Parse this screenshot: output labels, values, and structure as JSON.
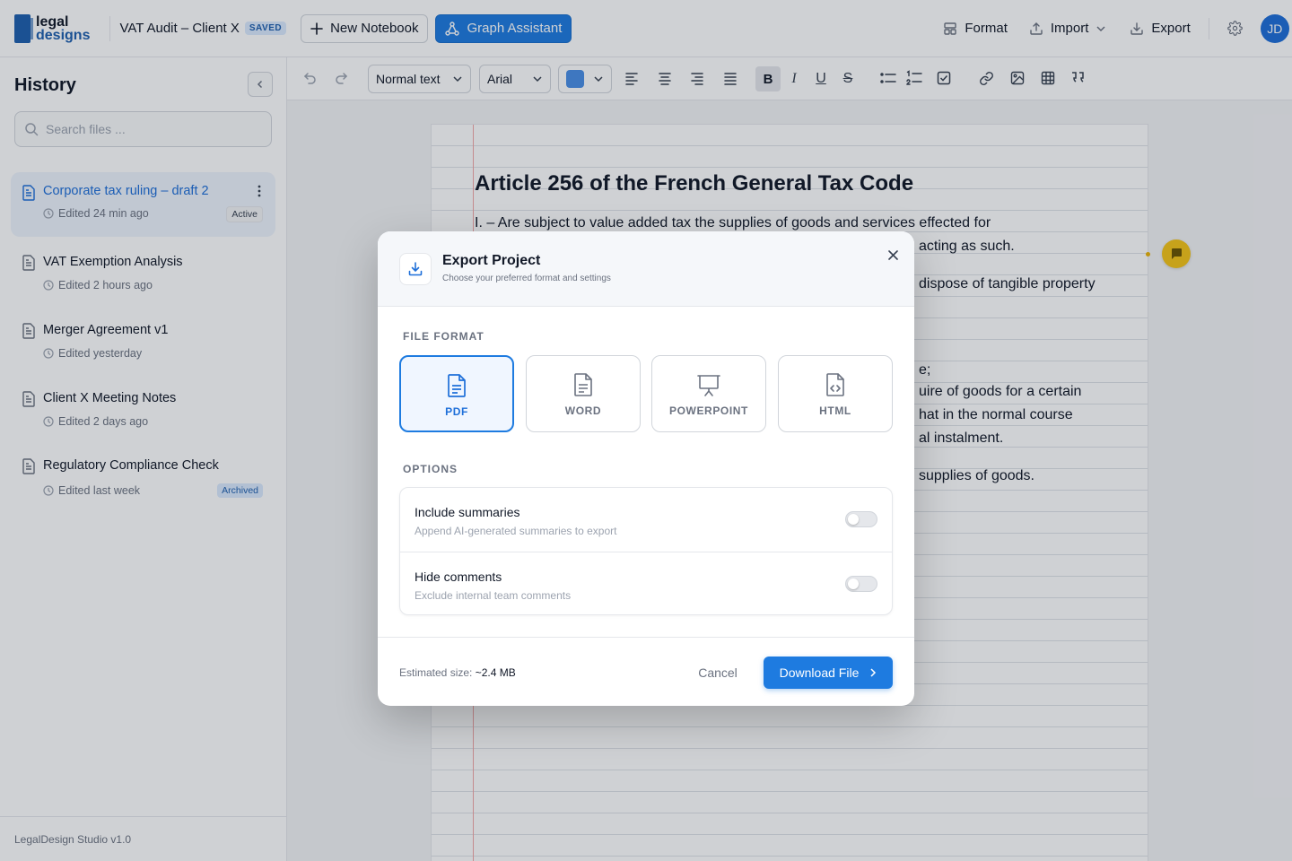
{
  "header": {
    "logo_line1": "legal",
    "logo_line2": "designs",
    "doc_title": "VAT Audit – Client X",
    "saved_badge": "SAVED",
    "new_notebook": "New Notebook",
    "graph_assistant": "Graph Assistant",
    "format": "Format",
    "import": "Import",
    "export": "Export",
    "avatar_initials": "JD"
  },
  "sidebar": {
    "title": "History",
    "search_placeholder": "Search files ...",
    "files": [
      {
        "name": "Corporate tax ruling – draft 2",
        "meta": "Edited 24 min ago",
        "badge": "Active"
      },
      {
        "name": "VAT Exemption Analysis",
        "meta": "Edited 2 hours ago",
        "badge": ""
      },
      {
        "name": "Merger Agreement v1",
        "meta": "Edited yesterday",
        "badge": ""
      },
      {
        "name": "Client X Meeting Notes",
        "meta": "Edited 2 days ago",
        "badge": ""
      },
      {
        "name": "Regulatory Compliance Check",
        "meta": "Edited last week",
        "badge": "Archived"
      }
    ],
    "footer": "LegalDesign Studio v1.0"
  },
  "toolbar": {
    "text_style": "Normal text",
    "font": "Arial",
    "text_color": "#4a8fe6",
    "bold": "B",
    "italic": "I",
    "underline": "U",
    "strike": "S"
  },
  "document": {
    "title": "Article 256 of the French General Tax Code",
    "lines": [
      "I. – Are subject to value added tax the supplies of goods and services effected for",
      "acting as such.",
      "dispose of tangible property",
      "e;",
      "uire of goods for a certain",
      "hat in the normal course",
      "al instalment.",
      "supplies of goods."
    ]
  },
  "modal": {
    "title": "Export Project",
    "subtitle": "Choose your preferred format and settings",
    "section_format": "FILE FORMAT",
    "formats": [
      {
        "label": "PDF",
        "icon": "pdf-file-icon",
        "selected": true
      },
      {
        "label": "WORD",
        "icon": "word-file-icon",
        "selected": false
      },
      {
        "label": "POWERPOINT",
        "icon": "presentation-icon",
        "selected": false
      },
      {
        "label": "HTML",
        "icon": "code-file-icon",
        "selected": false
      }
    ],
    "section_options": "OPTIONS",
    "options": [
      {
        "title": "Include summaries",
        "desc": "Append AI-generated summaries to export",
        "enabled": false
      },
      {
        "title": "Hide comments",
        "desc": "Exclude internal team comments",
        "enabled": false
      }
    ],
    "estimated_label": "Estimated size:",
    "estimated_value": "~2.4 MB",
    "cancel": "Cancel",
    "download": "Download File"
  },
  "colors": {
    "accent": "#1e7be0",
    "brand": "#1e5fae",
    "comment": "#f5c518"
  }
}
